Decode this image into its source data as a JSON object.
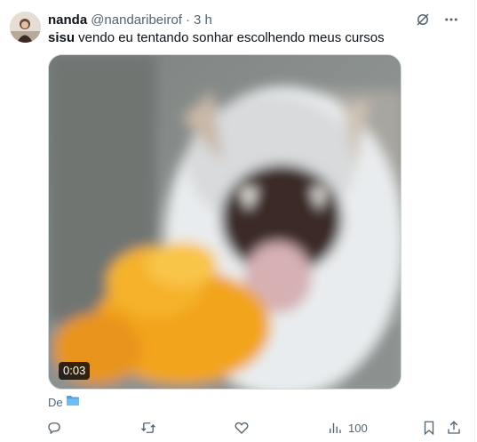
{
  "tweet": {
    "author_name": "nanda",
    "handle": "@nandaribeirof",
    "separator": "·",
    "time": "3 h",
    "text_bold": "sisu",
    "text_rest": " vendo eu tentando sonhar escolhendo meus cursos",
    "avatar_icon": "user-avatar"
  },
  "media": {
    "duration": "0:03",
    "description_icon": "video-thumbnail"
  },
  "source": {
    "label": "De",
    "icon": "folder-icon"
  },
  "actions": {
    "reply_count": "",
    "retweet_count": "",
    "like_count": "",
    "views_count": "100"
  },
  "colors": {
    "text_primary": "#0f1419",
    "text_secondary": "#536471",
    "border": "#cfd9de",
    "folder": "#4aa3e8"
  }
}
